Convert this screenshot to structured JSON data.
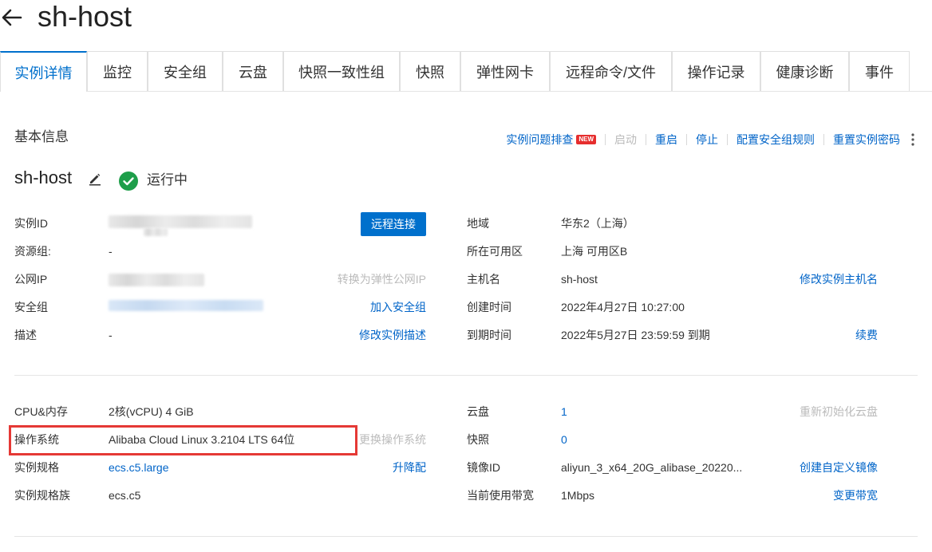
{
  "header": {
    "title": "sh-host"
  },
  "tabs": [
    {
      "label": "实例详情"
    },
    {
      "label": "监控"
    },
    {
      "label": "安全组"
    },
    {
      "label": "云盘"
    },
    {
      "label": "快照一致性组"
    },
    {
      "label": "快照"
    },
    {
      "label": "弹性网卡"
    },
    {
      "label": "远程命令/文件"
    },
    {
      "label": "操作记录"
    },
    {
      "label": "健康诊断"
    },
    {
      "label": "事件"
    }
  ],
  "basic": {
    "heading": "基本信息",
    "actions": {
      "troubleshoot": "实例问题排查",
      "new_badge": "NEW",
      "start": "启动",
      "restart": "重启",
      "stop": "停止",
      "config_sg": "配置安全组规则",
      "reset_password": "重置实例密码"
    },
    "instance_name": "sh-host",
    "status": "运行中",
    "remote_connect": "远程连接"
  },
  "left_info": {
    "instance_id_label": "实例ID",
    "resource_group_label": "资源组:",
    "resource_group_value": "-",
    "public_ip_label": "公网IP",
    "convert_eip": "转换为弹性公网IP",
    "security_group_label": "安全组",
    "join_sg": "加入安全组",
    "desc_label": "描述",
    "desc_value": "-",
    "modify_desc": "修改实例描述"
  },
  "right_info": {
    "region_label": "地域",
    "region_value": "华东2（上海）",
    "zone_label": "所在可用区",
    "zone_value": "上海 可用区B",
    "hostname_label": "主机名",
    "hostname_value": "sh-host",
    "modify_hostname": "修改实例主机名",
    "created_label": "创建时间",
    "created_value": "2022年4月27日 10:27:00",
    "expire_label": "到期时间",
    "expire_value": "2022年5月27日 23:59:59 到期",
    "renew": "续费"
  },
  "config_left": {
    "cpu_label": "CPU&内存",
    "cpu_value": "2核(vCPU) 4 GiB",
    "os_label": "操作系统",
    "os_value": "Alibaba Cloud Linux 3.2104 LTS 64位",
    "change_os": "更换操作系统",
    "spec_label": "实例规格",
    "spec_value": "ecs.c5.large",
    "upgrade": "升降配",
    "family_label": "实例规格族",
    "family_value": "ecs.c5"
  },
  "config_right": {
    "disk_label": "云盘",
    "disk_value": "1",
    "reinit_disk": "重新初始化云盘",
    "snapshot_label": "快照",
    "snapshot_value": "0",
    "image_label": "镜像ID",
    "image_value": "aliyun_3_x64_20G_alibase_20220...",
    "create_image": "创建自定义镜像",
    "bandwidth_label": "当前使用带宽",
    "bandwidth_value": "1Mbps",
    "change_bandwidth": "变更带宽"
  },
  "colors": {
    "accent": "#0070cc",
    "link": "#0064c8",
    "success": "#1e9e4a",
    "highlight": "#e53935"
  }
}
